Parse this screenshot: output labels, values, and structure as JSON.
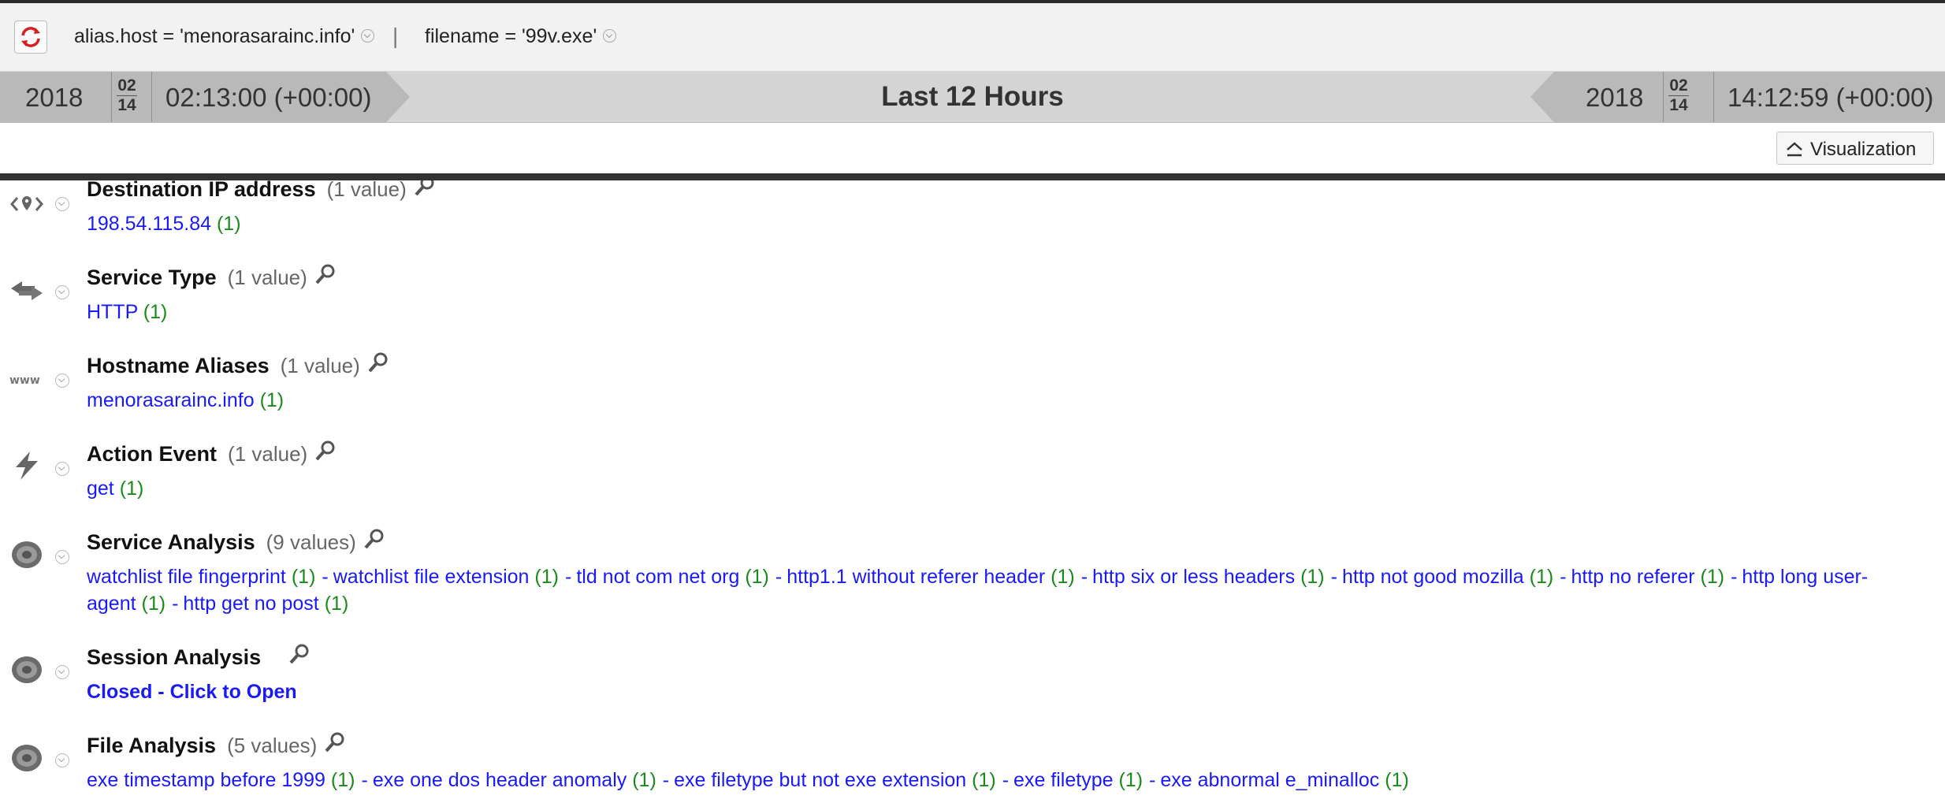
{
  "filters": [
    {
      "text": "alias.host = 'menorasarainc.info'"
    },
    {
      "text": "filename = '99v.exe'"
    }
  ],
  "filter_separator": "|",
  "timerange": {
    "start": {
      "year": "2018",
      "month": "02",
      "day": "14",
      "time": "02:13:00 (+00:00)"
    },
    "end": {
      "year": "2018",
      "month": "02",
      "day": "14",
      "time": "14:12:59 (+00:00)"
    },
    "label": "Last 12 Hours"
  },
  "toolbar": {
    "visualization_label": "Visualization"
  },
  "sections": [
    {
      "title": "Destination IP address",
      "count": "(1 value)",
      "icon": "destination-ip-icon",
      "values": [
        {
          "v": "198.54.115.84",
          "c": "(1)"
        }
      ]
    },
    {
      "title": "Service Type",
      "count": "(1 value)",
      "icon": "service-type-arrows-icon",
      "values": [
        {
          "v": "HTTP",
          "c": "(1)"
        }
      ]
    },
    {
      "title": "Hostname Aliases",
      "count": "(1 value)",
      "icon": "www-icon",
      "values": [
        {
          "v": "menorasarainc.info",
          "c": "(1)"
        }
      ]
    },
    {
      "title": "Action Event",
      "count": "(1 value)",
      "icon": "lightning-icon",
      "values": [
        {
          "v": "get",
          "c": "(1)"
        }
      ]
    },
    {
      "title": "Service Analysis",
      "count": "(9 values)",
      "icon": "analysis-disc-icon",
      "values": [
        {
          "v": "watchlist file fingerprint",
          "c": "(1)"
        },
        {
          "v": "watchlist file extension",
          "c": "(1)"
        },
        {
          "v": "tld not com net org",
          "c": "(1)"
        },
        {
          "v": "http1.1 without referer header",
          "c": "(1)"
        },
        {
          "v": "http six or less headers",
          "c": "(1)"
        },
        {
          "v": "http not good mozilla",
          "c": "(1)"
        },
        {
          "v": "http no referer",
          "c": "(1)"
        },
        {
          "v": "http long user-agent",
          "c": "(1)"
        },
        {
          "v": "http get no post",
          "c": "(1)"
        }
      ]
    },
    {
      "title": "Session Analysis",
      "count": "",
      "icon": "analysis-disc-icon",
      "open_link": "Closed - Click to Open"
    },
    {
      "title": "File Analysis",
      "count": "(5 values)",
      "icon": "analysis-disc-icon",
      "values": [
        {
          "v": "exe timestamp before 1999",
          "c": "(1)"
        },
        {
          "v": "exe one dos header anomaly",
          "c": "(1)"
        },
        {
          "v": "exe filetype but not exe extension",
          "c": "(1)"
        },
        {
          "v": "exe filetype",
          "c": "(1)"
        },
        {
          "v": "exe abnormal e_minalloc",
          "c": "(1)"
        }
      ]
    }
  ]
}
